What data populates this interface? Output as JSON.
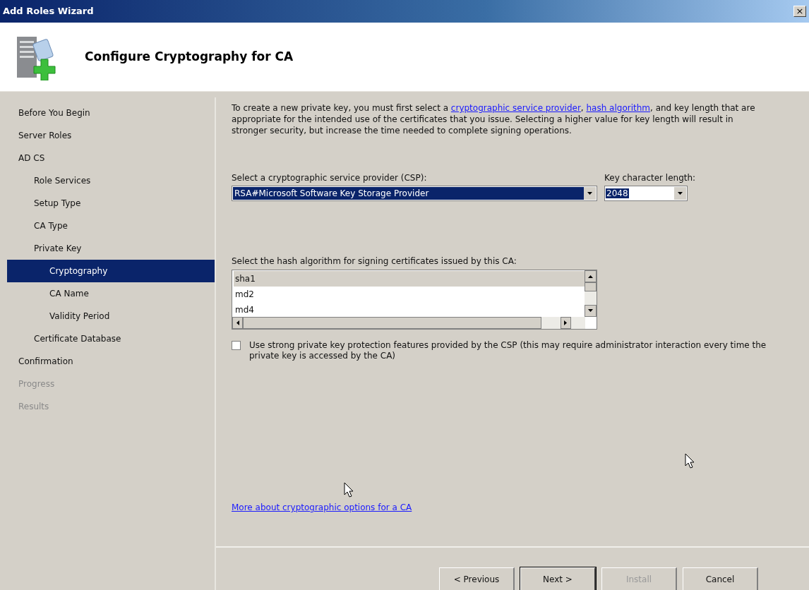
{
  "window": {
    "title": "Add Roles Wizard",
    "close": "×"
  },
  "header": {
    "title": "Configure Cryptography for CA"
  },
  "sidebar": {
    "items": [
      {
        "label": "Before You Begin",
        "selected": false,
        "disabled": false
      },
      {
        "label": "Server Roles",
        "selected": false,
        "disabled": false
      },
      {
        "label": "AD CS",
        "selected": false,
        "disabled": false,
        "children": [
          {
            "label": "Role Services",
            "selected": false,
            "disabled": false
          },
          {
            "label": "Setup Type",
            "selected": false,
            "disabled": false
          },
          {
            "label": "CA Type",
            "selected": false,
            "disabled": false
          },
          {
            "label": "Private Key",
            "selected": false,
            "disabled": false,
            "children": [
              {
                "label": "Cryptography",
                "selected": true,
                "disabled": false
              },
              {
                "label": "CA Name",
                "selected": false,
                "disabled": false
              },
              {
                "label": "Validity Period",
                "selected": false,
                "disabled": false
              }
            ]
          },
          {
            "label": "Certificate Database",
            "selected": false,
            "disabled": false
          }
        ]
      },
      {
        "label": "Confirmation",
        "selected": false,
        "disabled": false
      },
      {
        "label": "Progress",
        "selected": false,
        "disabled": true
      },
      {
        "label": "Results",
        "selected": false,
        "disabled": true
      }
    ]
  },
  "content": {
    "intro": [
      "To create a new private key, you must first select a ",
      "cryptographic service provider",
      ", ",
      "hash algorithm",
      ", and key length that are appropriate for the intended use of the certificates that you issue. Selecting a higher value for key length will result in stronger security, but increase the time needed to complete signing operations."
    ],
    "csp_label": "Select a cryptographic service provider (CSP):",
    "csp_value": "RSA#Microsoft Software Key Storage Provider",
    "key_length_label": "Key character length:",
    "key_length_value": "2048",
    "hash_label": "Select the hash algorithm for signing certificates issued by this CA:",
    "hash_items": [
      {
        "label": "sha1",
        "selected": true
      },
      {
        "label": "md2",
        "selected": false
      },
      {
        "label": "md4",
        "selected": false
      }
    ],
    "strong_protection": {
      "label": "Use strong private key protection features provided by the CSP (this may require administrator interaction every time the private key is accessed by the CA)",
      "checked": false
    },
    "more_link": "More about cryptographic options for a CA"
  },
  "buttons": [
    {
      "label": "< Previous",
      "disabled": false,
      "default": false
    },
    {
      "label": "Next >",
      "disabled": false,
      "default": true
    },
    {
      "label": "Install",
      "disabled": true,
      "default": false
    },
    {
      "label": "Cancel",
      "disabled": false,
      "default": false
    }
  ]
}
